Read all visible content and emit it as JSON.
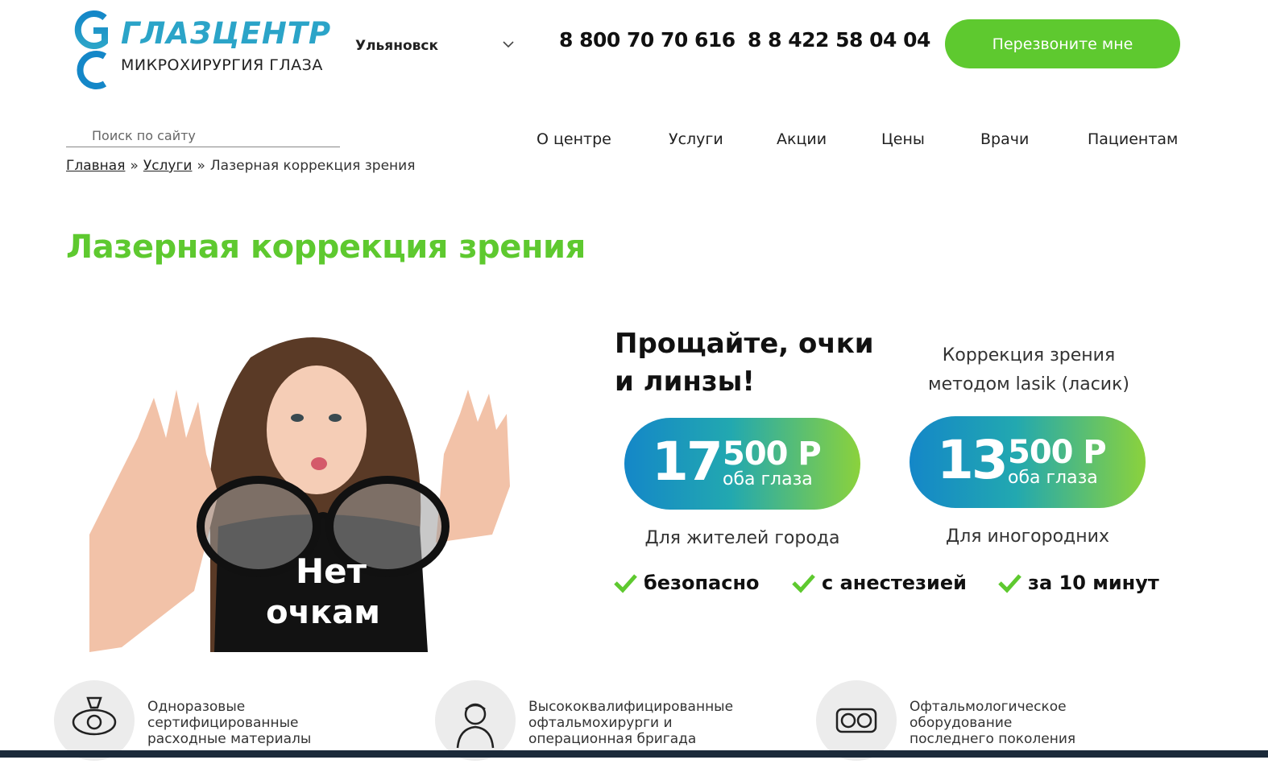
{
  "header": {
    "logo": {
      "title": "ГЛАЗЦЕНТР",
      "subtitle": "МИКРОХИРУРГИЯ ГЛАЗА"
    },
    "city": "Ульяновск",
    "phones": [
      "8 800 70 70 616",
      "8 8 422 58 04 04"
    ],
    "callback_label": "Перезвоните мне"
  },
  "search": {
    "placeholder": "Поиск по сайту"
  },
  "nav": [
    {
      "label": "О центре"
    },
    {
      "label": "Услуги"
    },
    {
      "label": "Акции"
    },
    {
      "label": "Цены"
    },
    {
      "label": "Врачи"
    },
    {
      "label": "Пациентам"
    }
  ],
  "breadcrumbs": {
    "home": "Главная",
    "services": "Услуги",
    "separator": "»",
    "current": "Лазерная коррекция зрения"
  },
  "page_title": "Лазерная коррекция зрения",
  "hero": {
    "shirt_line1": "Нет",
    "shirt_line2": "очкам"
  },
  "promo": {
    "slogan": "Прощайте, очки и линзы!",
    "method_line1": "Коррекция зрения",
    "method_line2": "методом lasik (ласик)",
    "prices": [
      {
        "big": "17",
        "small": "500 Р",
        "unit": "оба глаза",
        "note": "Для жителей города"
      },
      {
        "big": "13",
        "small": "500 Р",
        "unit": "оба глаза",
        "note": "Для иногородних"
      }
    ],
    "features": [
      "безопасно",
      "с анестезией",
      "за 10 минут"
    ]
  },
  "advantages": [
    {
      "icon": "eye-lens-icon",
      "lines": [
        "Одноразовые",
        "сертифицированные",
        "расходные материалы"
      ]
    },
    {
      "icon": "doctor-icon",
      "lines": [
        "Высококвалифицированные",
        "офтальмохирурги и",
        "операционная бригада"
      ]
    },
    {
      "icon": "eye-equipment-icon",
      "lines": [
        "Офтальмологическое",
        "оборудование",
        "последнего поколения"
      ]
    }
  ],
  "colors": {
    "accent_green": "#5ec92f",
    "brand_blue": "#1487c8",
    "dark": "#111111"
  }
}
